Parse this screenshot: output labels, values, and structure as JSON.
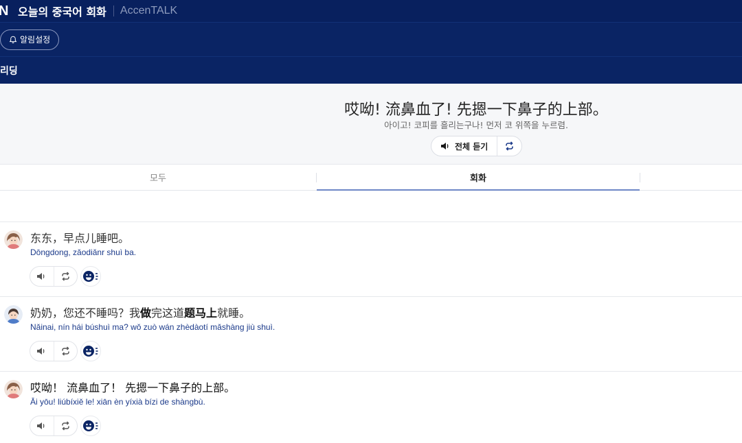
{
  "header": {
    "logo": "N",
    "app_title": "오늘의 중국어 회화",
    "brand": "AccenTALK"
  },
  "subheader": {
    "alarm_button": "알림설정"
  },
  "section": {
    "title": "리딩"
  },
  "hero": {
    "chinese": "哎呦! 流鼻血了! 先摁一下鼻子的上部。",
    "korean": "아이고! 코피를 흘리는구나! 먼저 코 위쪽을 누르렴.",
    "play_all_label": "전체 듣기"
  },
  "tabs": [
    {
      "label": "모두",
      "active": false
    },
    {
      "label": "회화",
      "active": true
    }
  ],
  "dialogues": [
    {
      "speaker": "grandma",
      "chinese": "东东，早点儿睡吧。",
      "pinyin": "Dōngdong, zǎodiǎnr shuì ba."
    },
    {
      "speaker": "boy",
      "chinese_parts": [
        "奶奶，您还不睡吗？我",
        "做",
        "完这道",
        "题马上",
        "就睡。"
      ],
      "pinyin": "Nǎinai, nín hái búshuì ma? wǒ zuò wán zhèdàotí mǎshàng jiù shuì."
    },
    {
      "speaker": "grandma",
      "chinese": "哎呦！ 流鼻血了！ 先摁一下鼻子的上部。",
      "pinyin": "Āi yōu! liúbíxiě le! xiān èn yíxià bízi de shàngbù."
    }
  ],
  "icons": {
    "speaker": "speaker-icon",
    "repeat": "repeat-icon",
    "face": "speaking-face-icon",
    "bell": "bell-icon"
  },
  "colors": {
    "header_bg": "#08205e",
    "accent": "#6d86c6",
    "pinyin": "#1b3a8a"
  }
}
